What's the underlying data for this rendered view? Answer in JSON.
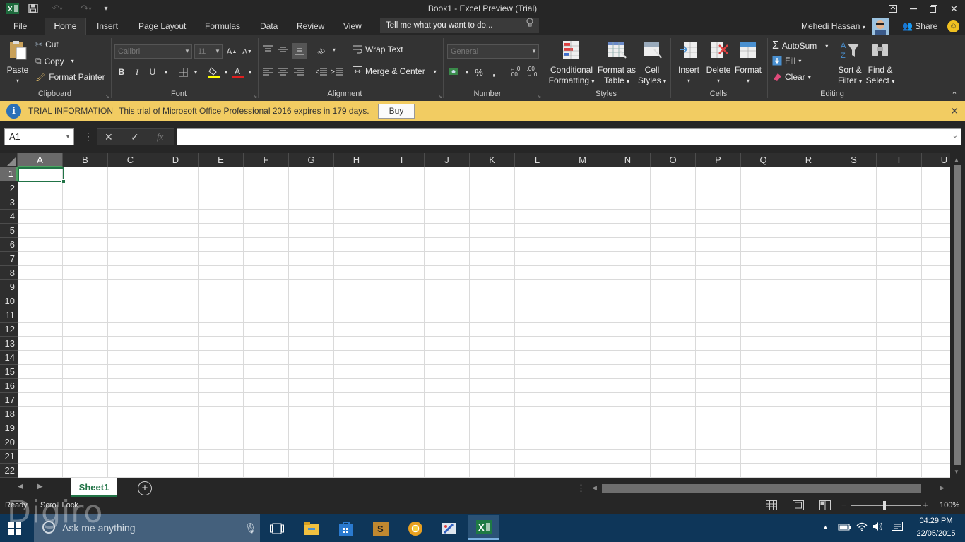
{
  "window": {
    "title": "Book1 - Excel Preview (Trial)"
  },
  "tabs": [
    {
      "label": "File"
    },
    {
      "label": "Home"
    },
    {
      "label": "Insert"
    },
    {
      "label": "Page Layout"
    },
    {
      "label": "Formulas"
    },
    {
      "label": "Data"
    },
    {
      "label": "Review"
    },
    {
      "label": "View"
    }
  ],
  "tellme": {
    "placeholder": "Tell me what you want to do..."
  },
  "user": {
    "name": "Mehedi Hassan",
    "share": "Share"
  },
  "ribbon": {
    "clipboard": {
      "label": "Clipboard",
      "paste": "Paste",
      "cut": "Cut",
      "copy": "Copy",
      "format_painter": "Format Painter"
    },
    "font": {
      "label": "Font",
      "font_name": "Calibri",
      "font_size": "11",
      "bold": "B",
      "italic": "I",
      "underline": "U"
    },
    "alignment": {
      "label": "Alignment",
      "wrap_text": "Wrap Text",
      "merge_center": "Merge & Center"
    },
    "number": {
      "label": "Number",
      "format": "General",
      "percent": "%",
      "comma": ","
    },
    "styles": {
      "label": "Styles",
      "conditional_1": "Conditional",
      "conditional_2": "Formatting",
      "format_table_1": "Format as",
      "format_table_2": "Table",
      "cell_styles_1": "Cell",
      "cell_styles_2": "Styles"
    },
    "cells": {
      "label": "Cells",
      "insert": "Insert",
      "delete": "Delete",
      "format": "Format"
    },
    "editing": {
      "label": "Editing",
      "autosum": "AutoSum",
      "fill": "Fill",
      "clear": "Clear",
      "sort_1": "Sort &",
      "sort_2": "Filter",
      "find_1": "Find &",
      "find_2": "Select"
    }
  },
  "trial": {
    "heading": "TRIAL INFORMATION",
    "message": "This trial of Microsoft Office Professional 2016 expires in 179 days.",
    "buy": "Buy"
  },
  "formula_bar": {
    "name_box": "A1",
    "fx": "fx",
    "value": ""
  },
  "columns": [
    "A",
    "B",
    "C",
    "D",
    "E",
    "F",
    "G",
    "H",
    "I",
    "J",
    "K",
    "L",
    "M",
    "N",
    "O",
    "P",
    "Q",
    "R",
    "S",
    "T",
    "U"
  ],
  "rows": [
    "1",
    "2",
    "3",
    "4",
    "5",
    "6",
    "7",
    "8",
    "9",
    "10",
    "11",
    "12",
    "13",
    "14",
    "15",
    "16",
    "17",
    "18",
    "19",
    "20",
    "21",
    "22"
  ],
  "selected_cell": "A1",
  "sheets": [
    {
      "name": "Sheet1"
    }
  ],
  "status": {
    "ready": "Ready",
    "scroll_lock": "Scroll Lock",
    "zoom": "100%"
  },
  "taskbar": {
    "search_placeholder": "Ask me anything",
    "time": "04:29 PM",
    "date": "22/05/2015"
  },
  "watermark": "Digiro",
  "colors": {
    "excel_green": "#217346",
    "trial_bar": "#f2cc62",
    "ribbon": "#333333",
    "taskbar": "#0e3659"
  }
}
